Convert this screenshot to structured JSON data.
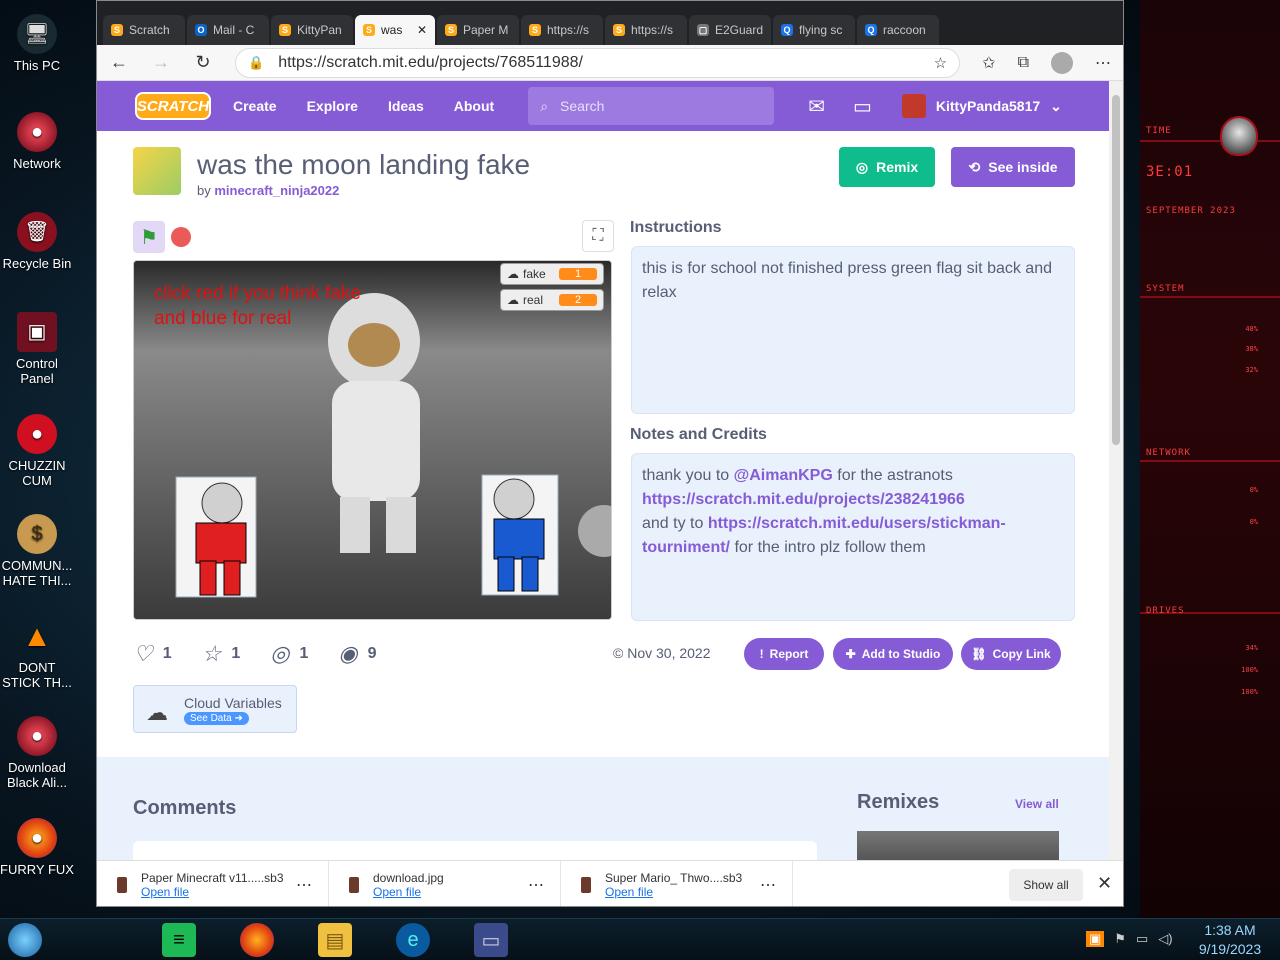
{
  "desktop": {
    "icons": [
      {
        "label": "This PC",
        "glyph": "🖥"
      },
      {
        "label": "Network",
        "glyph": "●"
      },
      {
        "label": "Recycle Bin",
        "glyph": "🗑"
      },
      {
        "label": "Control Panel",
        "glyph": "▣"
      },
      {
        "label": "CHUZZIN CUM",
        "glyph": "●"
      },
      {
        "label": "COMMUN... HATE THI...",
        "glyph": "$"
      },
      {
        "label": "DONT STICK TH...",
        "glyph": "▲"
      },
      {
        "label": "Download Black Ali...",
        "glyph": "●"
      },
      {
        "label": "FURRY FUX",
        "glyph": "●"
      }
    ]
  },
  "browser": {
    "tabs": [
      {
        "label": "Scratch",
        "fav": "S",
        "color": "#ffab19"
      },
      {
        "label": "Mail - C",
        "fav": "O",
        "color": "#0a64c8"
      },
      {
        "label": "KittyPan",
        "fav": "S",
        "color": "#ffab19"
      },
      {
        "label": "was",
        "fav": "S",
        "color": "#ffab19",
        "active": true
      },
      {
        "label": "Paper M",
        "fav": "S",
        "color": "#ffab19"
      },
      {
        "label": "https://s",
        "fav": "S",
        "color": "#ffab19"
      },
      {
        "label": "https://s",
        "fav": "S",
        "color": "#ffab19"
      },
      {
        "label": "E2Guard",
        "fav": "▢",
        "color": "#777"
      },
      {
        "label": "flying sc",
        "fav": "Q",
        "color": "#1a73e8"
      },
      {
        "label": "raccoon",
        "fav": "Q",
        "color": "#1a73e8"
      }
    ],
    "url": "https://scratch.mit.edu/projects/768511988/"
  },
  "scratch": {
    "nav": {
      "logo": "SCRATCH",
      "create": "Create",
      "explore": "Explore",
      "ideas": "Ideas",
      "about": "About",
      "search_placeholder": "Search",
      "username": "KittyPanda5817"
    },
    "project": {
      "title": "was the moon landing fake",
      "by": "by ",
      "author": "minecraft_ninja2022",
      "remix": "Remix",
      "see_inside": "See inside"
    },
    "stage": {
      "text_line1": "click red if you think fake",
      "text_line2": "and blue for real",
      "monitors": [
        {
          "name": "fake",
          "value": "1"
        },
        {
          "name": "real",
          "value": "2"
        }
      ]
    },
    "instructions": {
      "heading": "Instructions",
      "text": "this is for school not finished press green flag sit back and relax"
    },
    "notes": {
      "heading": "Notes and Credits",
      "l1a": "thank you to ",
      "l1b": "@AimanKPG",
      "l1c": " for the astranots",
      "l2": "https://scratch.mit.edu/projects/238241966",
      "l3a": "and ty to ",
      "l3b": "https://scratch.mit.edu/users/stickman-tourniment/",
      "l3c": " for the intro plz follow them"
    },
    "stats": {
      "loves": "1",
      "favorites": "1",
      "remixes": "1",
      "views": "9"
    },
    "date": "© Nov 30, 2022",
    "actions": {
      "report": "Report",
      "add_studio": "Add to Studio",
      "copy_link": "Copy Link"
    },
    "cloud": {
      "label": "Cloud Variables",
      "see_data": "See Data ➜"
    },
    "comments_heading": "Comments",
    "remixes_heading": "Remixes",
    "view_all": "View all"
  },
  "downloads": [
    {
      "name": "Paper Minecraft v11.....sb3",
      "open": "Open file"
    },
    {
      "name": "download.jpg",
      "open": "Open file"
    },
    {
      "name": "Super Mario_ Thwo....sb3",
      "open": "Open file"
    }
  ],
  "downloads_show_all": "Show all",
  "clock": {
    "time": "1:38 AM",
    "date": "9/19/2023"
  }
}
